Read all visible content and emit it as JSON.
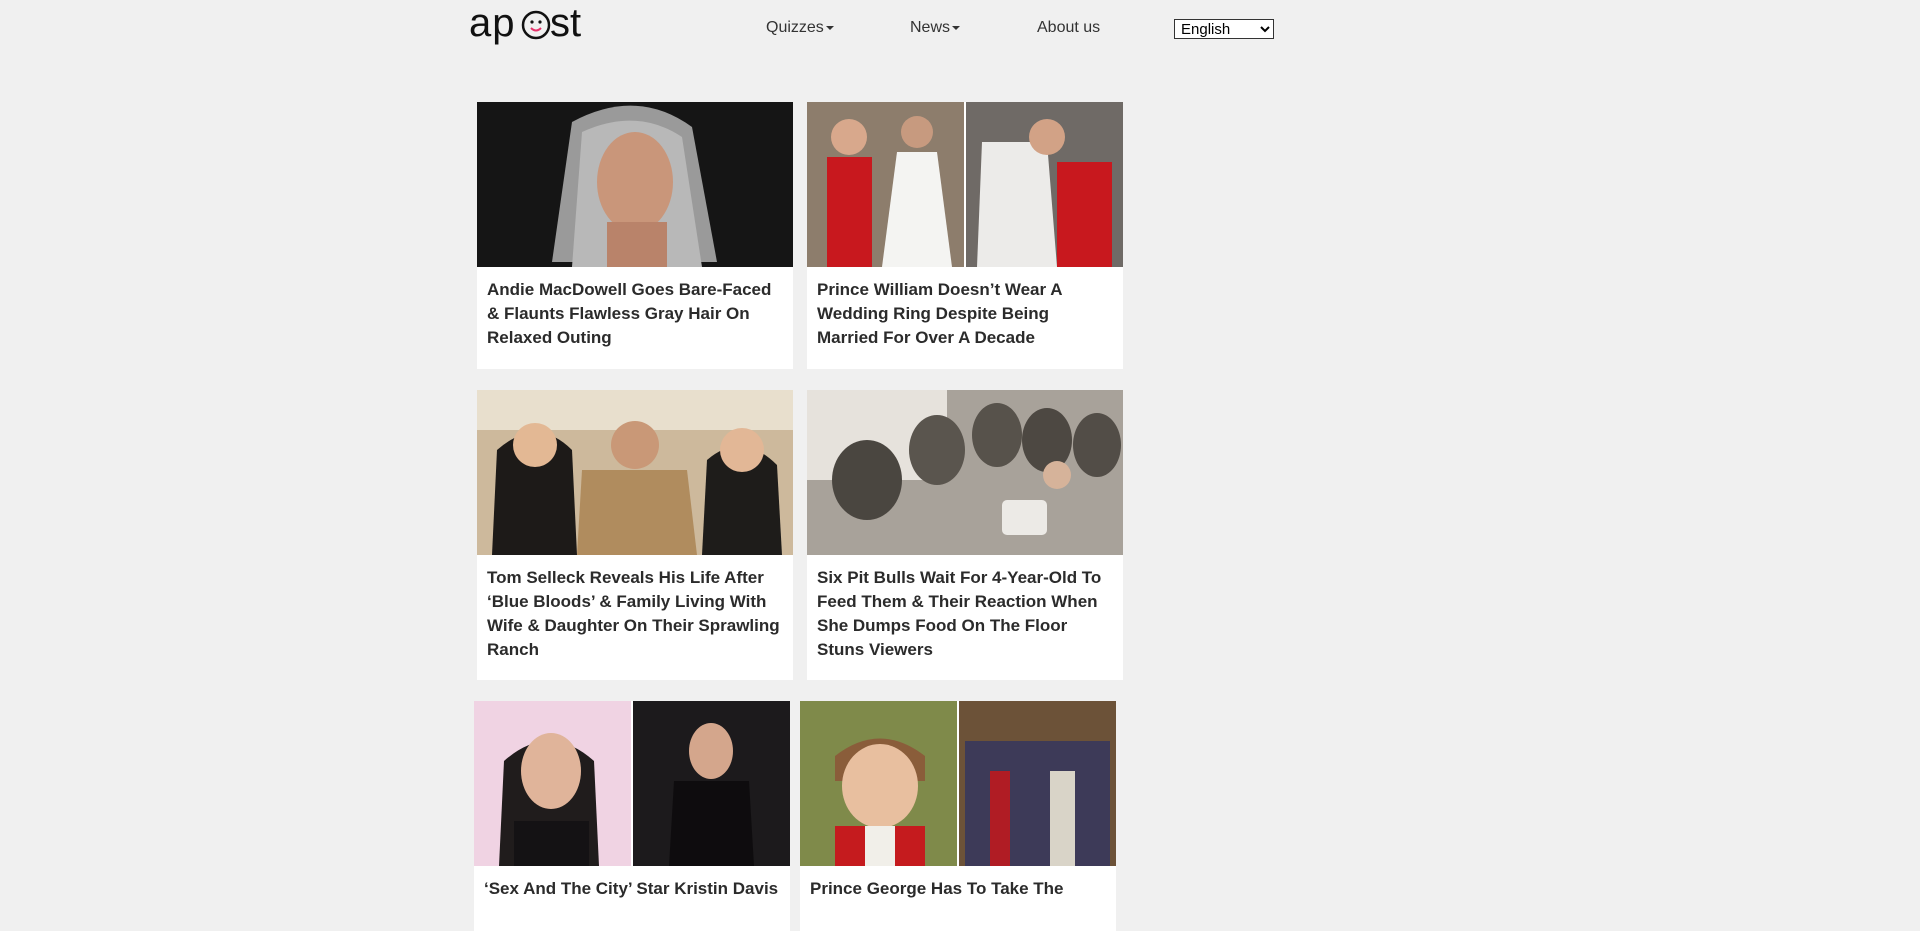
{
  "header": {
    "logo_alt": "apost",
    "nav": {
      "quizzes": "Quizzes",
      "news": "News",
      "about": "About us"
    },
    "language": {
      "selected": "English"
    }
  },
  "articles": [
    {
      "title": "Andie MacDowell Goes Bare-Faced & Flaunts Flawless Gray Hair On Relaxed Outing"
    },
    {
      "title": "Prince William Doesn’t Wear A Wedding Ring Despite Being Married For Over A Decade"
    },
    {
      "title": "Tom Selleck Reveals His Life After ‘Blue Bloods’ & Family Living With Wife & Daughter On Their Sprawling Ranch"
    },
    {
      "title": "Six Pit Bulls Wait For 4-Year-Old To Feed Them & Their Reaction When She Dumps Food On The Floor Stuns Viewers"
    },
    {
      "title": "‘Sex And The City’ Star Kristin Davis"
    },
    {
      "title": "Prince George Has To Take The"
    }
  ],
  "colors": {
    "background": "#f0f0f0",
    "card": "#ffffff",
    "title_text": "#2b2b2b"
  }
}
